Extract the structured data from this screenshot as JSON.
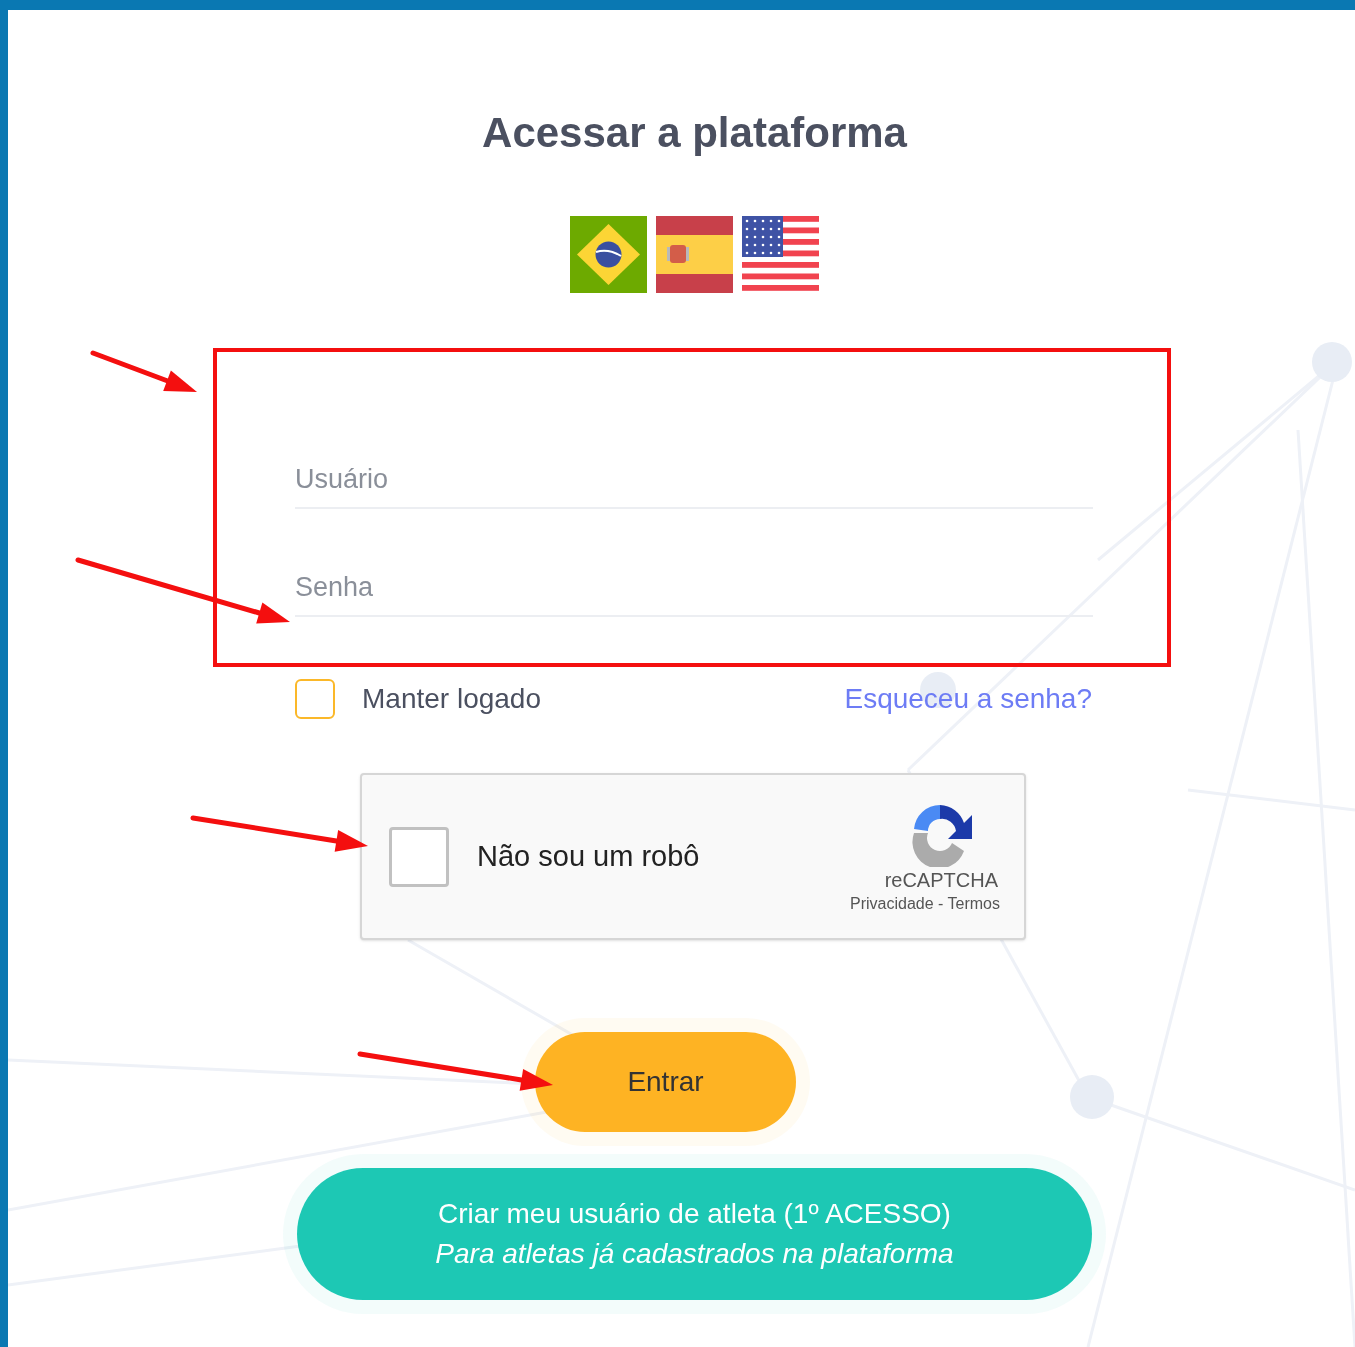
{
  "title": "Acessar a plataforma",
  "languages": [
    {
      "kind": "brazil"
    },
    {
      "kind": "spain"
    },
    {
      "kind": "usa"
    }
  ],
  "username": {
    "placeholder": "Usuário"
  },
  "password": {
    "placeholder": "Senha"
  },
  "remember": {
    "label": "Manter logado",
    "checked": false
  },
  "forgot_link": "Esqueceu a senha?",
  "captcha": {
    "label": "Não sou um robô",
    "checked": false,
    "brand": "reCAPTCHA",
    "links": "Privacidade - Termos"
  },
  "login_button": "Entrar",
  "signup_button": {
    "line_1": "Criar meu usuário de atleta (1º ACESSO)",
    "line_2": "Para atletas já cadastrados na plataforma"
  }
}
